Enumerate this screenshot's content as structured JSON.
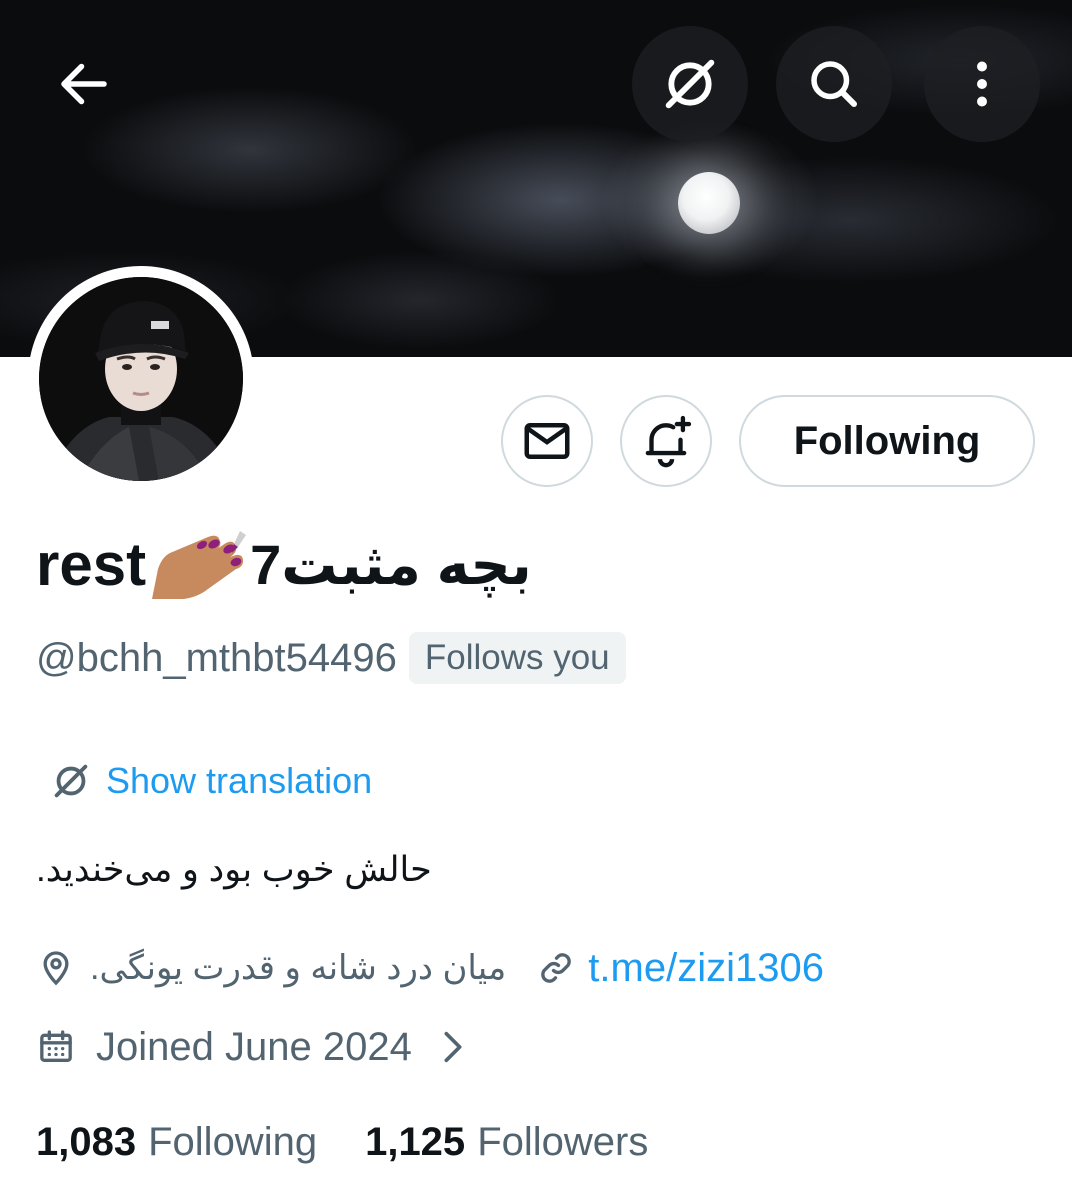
{
  "header": {
    "back_icon": "arrow-left-icon",
    "translate_icon": "translate-icon",
    "search_icon": "search-icon",
    "more_icon": "more-vertical-icon"
  },
  "profile": {
    "name_latin": "rest",
    "name_emoji": "💅🏽",
    "name_persian": "بچه مثبت7",
    "handle": "@bchh_mthbt54496",
    "follows_you": "Follows you",
    "show_translation": "Show translation",
    "bio": "حالش خوب بود و می‌خندید.",
    "location": "میان درد شانه و قدرت یونگی.",
    "link": "t.me/zizi1306",
    "joined": "Joined June 2024"
  },
  "actions": {
    "message_icon": "mail-icon",
    "notify_icon": "bell-plus-icon",
    "following_label": "Following"
  },
  "stats": {
    "following_count": "1,083",
    "following_label": "Following",
    "followers_count": "1,125",
    "followers_label": "Followers"
  },
  "colors": {
    "accent": "#1d9bf0",
    "text": "#0f1419",
    "muted": "#536471",
    "border": "#cfd9de"
  }
}
